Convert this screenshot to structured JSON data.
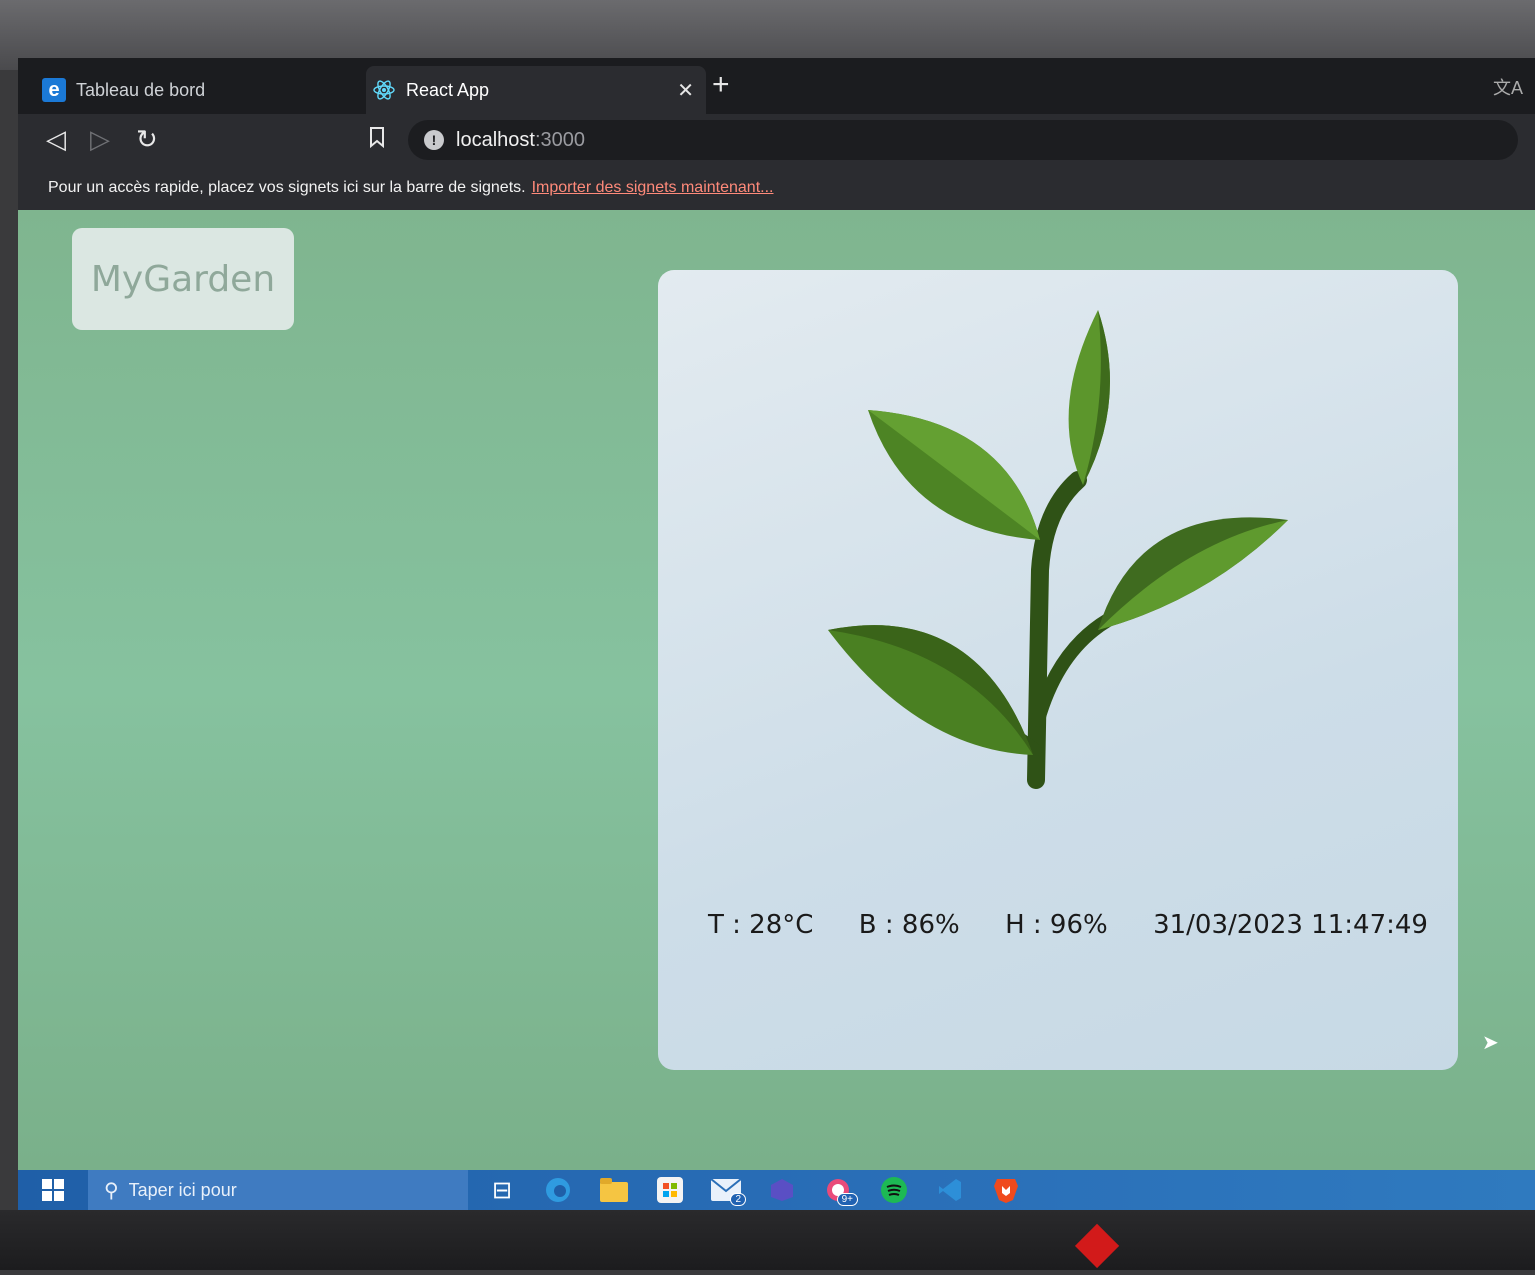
{
  "browser": {
    "tabs": [
      {
        "label": "Tableau de bord",
        "icon": "edge-icon",
        "active": false
      },
      {
        "label": "React App",
        "icon": "react-icon",
        "active": true
      }
    ],
    "address": {
      "host": "localhost",
      "port": ":3000"
    },
    "bookmarks_bar": {
      "text": "Pour un accès rapide, placez vos signets ici sur la barre de signets.",
      "link": "Importer des signets maintenant..."
    }
  },
  "app": {
    "logo": "MyGarden",
    "readings": {
      "temperature": "T : 28°C",
      "battery": "B : 86%",
      "humidity": "H : 96%",
      "datetime": "31/03/2023 11:47:49"
    },
    "colors": {
      "page_background": "#86c29f",
      "card_background": "#d6e3ec",
      "leaf_dark": "#3f6b1f",
      "leaf_light": "#5f9a2e"
    }
  },
  "taskbar": {
    "search_placeholder": "Taper ici pour",
    "mail_badge": "2",
    "copilot_badge": "9+"
  }
}
